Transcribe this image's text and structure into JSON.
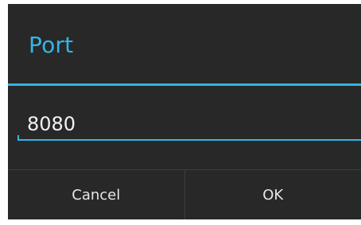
{
  "dialog": {
    "title": "Port",
    "input_value": "8080",
    "buttons": {
      "cancel_label": "Cancel",
      "ok_label": "OK"
    }
  },
  "colors": {
    "accent": "#33b5e5",
    "background": "#282828",
    "text": "#f2f2f2",
    "divider": "#3f3f3f"
  }
}
